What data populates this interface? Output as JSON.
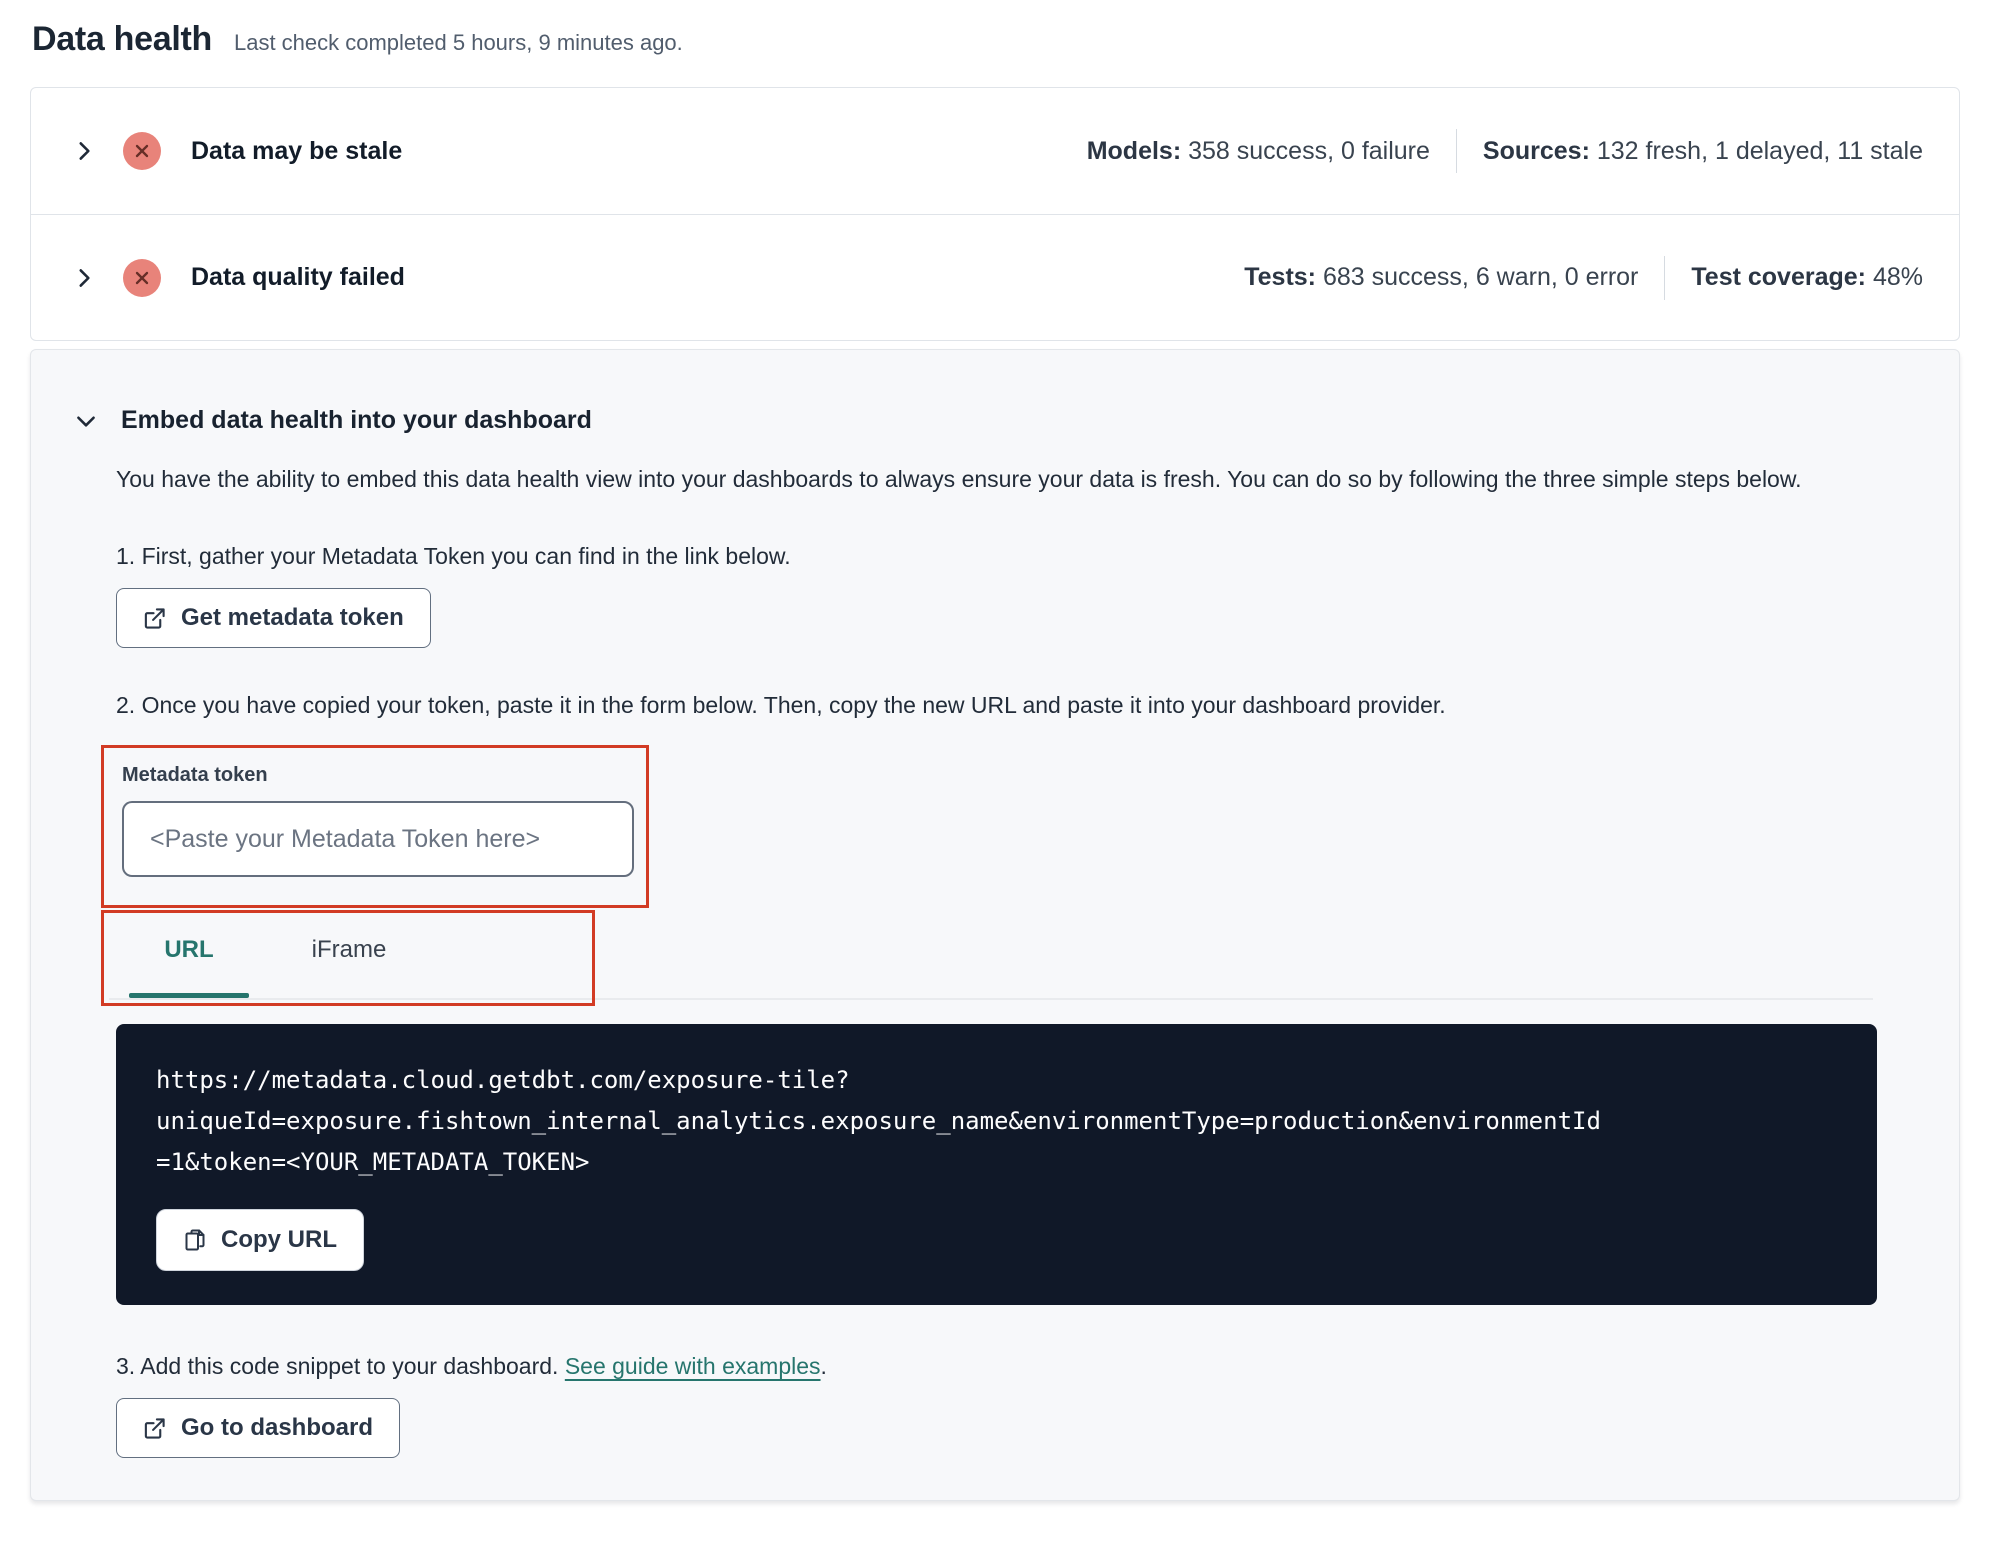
{
  "page": {
    "title": "Data health",
    "subtitle": "Last check completed 5 hours, 9 minutes ago."
  },
  "status_rows": [
    {
      "label": "Data may be stale",
      "status_icon": "error-x-circle",
      "stats": [
        {
          "label": "Models:",
          "value": "358 success, 0 failure"
        },
        {
          "label": "Sources:",
          "value": "132 fresh, 1 delayed, 11 stale"
        }
      ]
    },
    {
      "label": "Data quality failed",
      "status_icon": "error-x-circle",
      "stats": [
        {
          "label": "Tests:",
          "value": "683 success, 6 warn, 0 error"
        },
        {
          "label": "Test coverage:",
          "value": "48%"
        }
      ]
    }
  ],
  "embed": {
    "title": "Embed data health into your dashboard",
    "description": "You have the ability to embed this data health view into your dashboards to always ensure your data is fresh. You can do so by following the three simple steps below.",
    "step1": "1. First, gather your Metadata Token you can find in the link below.",
    "get_token_button": "Get metadata token",
    "step2": "2. Once you have copied your token, paste it in the form below. Then, copy the new URL and paste it into your dashboard provider.",
    "token_field": {
      "label": "Metadata token",
      "value": "",
      "placeholder": "<Paste your Metadata Token here>"
    },
    "tabs": [
      {
        "label": "URL",
        "active": true
      },
      {
        "label": "iFrame",
        "active": false
      }
    ],
    "code_url": "https://metadata.cloud.getdbt.com/exposure-tile?\nuniqueId=exposure.fishtown_internal_analytics.exposure_name&environmentType=production&environmentId\n=1&token=<YOUR_METADATA_TOKEN>",
    "copy_url_button": "Copy URL",
    "step3_prefix": "3. Add this code snippet to your dashboard. ",
    "step3_link": "See guide with examples",
    "step3_suffix": ".",
    "dashboard_button": "Go to dashboard"
  },
  "colors": {
    "teal": "#26756d",
    "annotation_red": "#d23b24",
    "error_badge_bg": "#e8837a",
    "error_badge_x": "#662e27",
    "code_block_bg": "#101828"
  }
}
